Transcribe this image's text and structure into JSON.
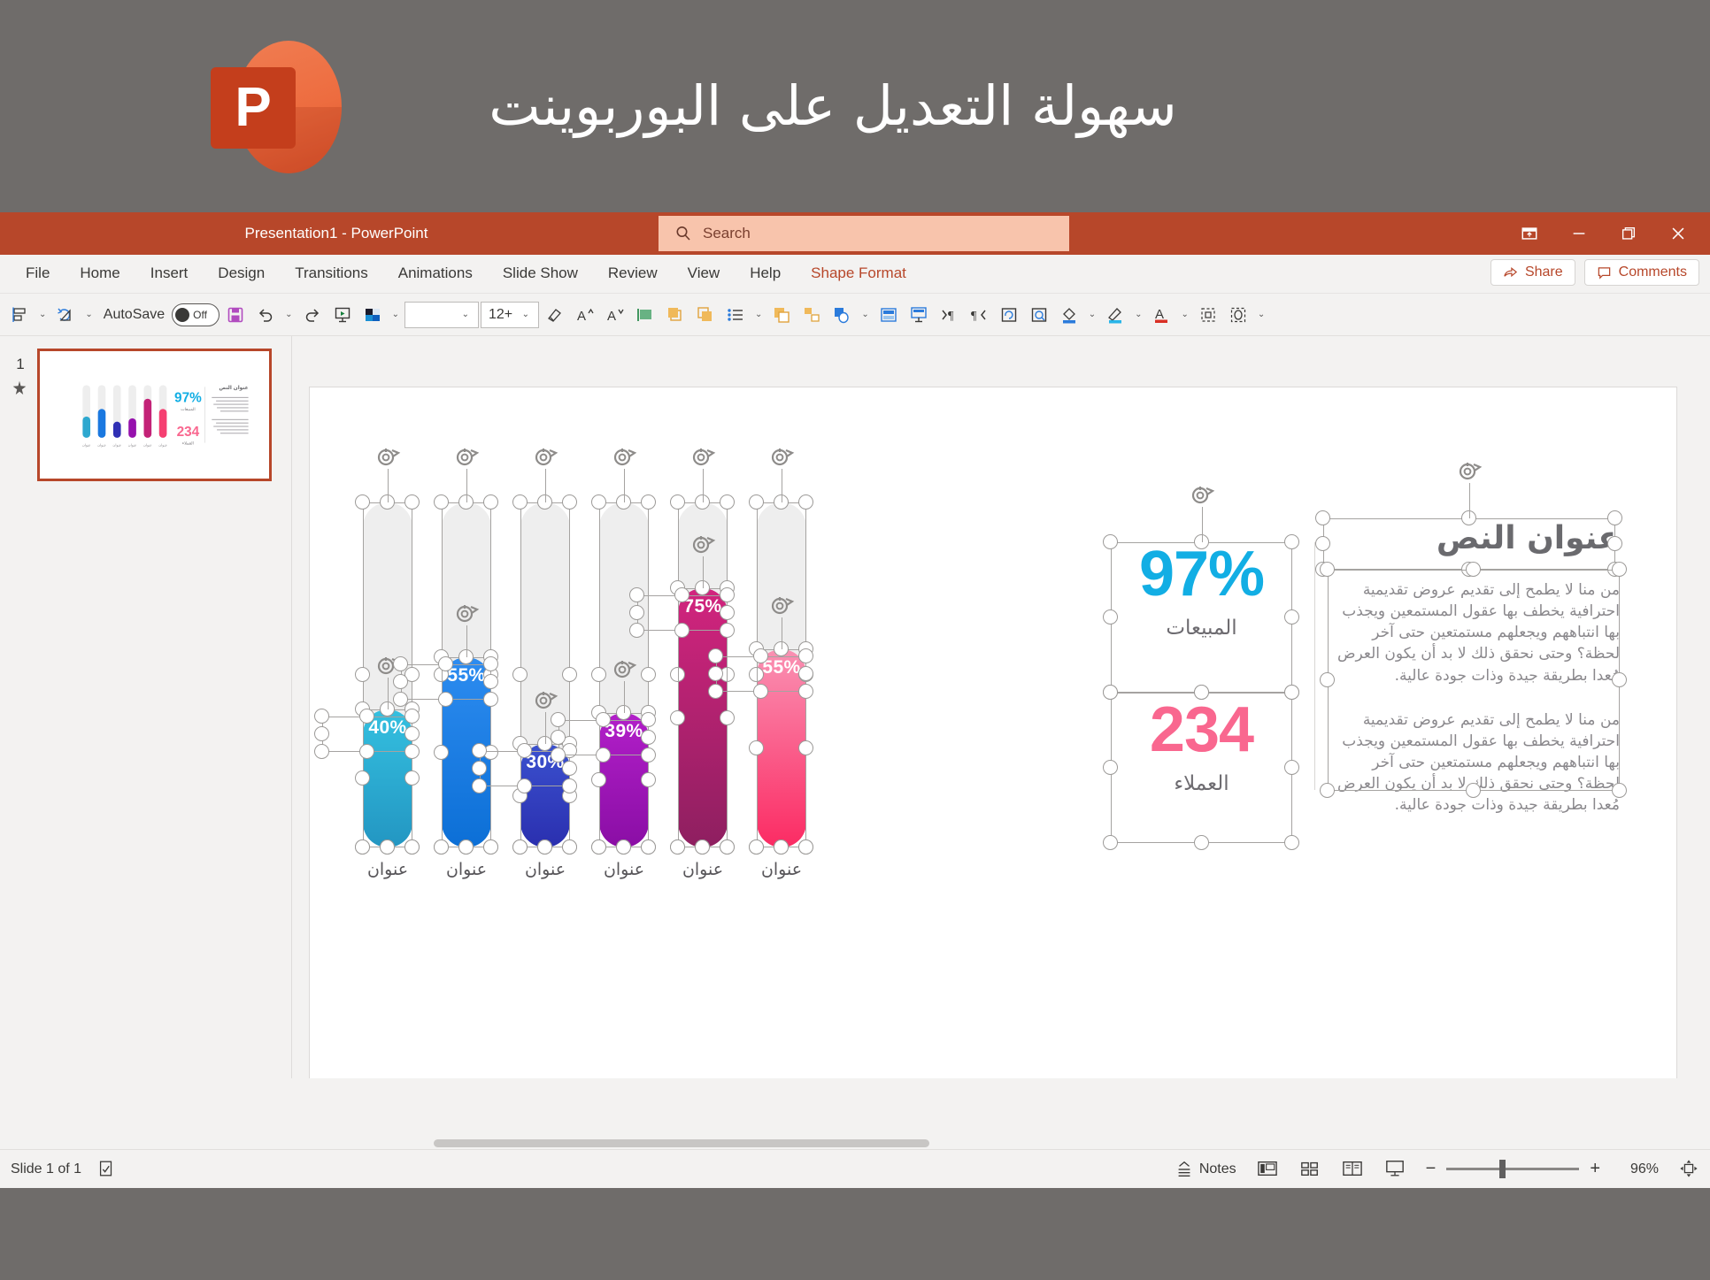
{
  "promo": {
    "title": "سهولة التعديل على البوربوينت",
    "logo_letter": "P",
    "logo_name": "powerpoint-logo"
  },
  "titlebar": {
    "document_title": "Presentation1  -  PowerPoint",
    "search_placeholder": "Search",
    "search_value": "",
    "buttons": {
      "ribbon_display": "ribbon-display-options",
      "minimize": "minimize",
      "restore": "restore",
      "close": "close"
    }
  },
  "ribbon": {
    "tabs": [
      {
        "label": "File",
        "active": false
      },
      {
        "label": "Home",
        "active": false
      },
      {
        "label": "Insert",
        "active": false
      },
      {
        "label": "Design",
        "active": false
      },
      {
        "label": "Transitions",
        "active": false
      },
      {
        "label": "Animations",
        "active": false
      },
      {
        "label": "Slide Show",
        "active": false
      },
      {
        "label": "Review",
        "active": false
      },
      {
        "label": "View",
        "active": false
      },
      {
        "label": "Help",
        "active": false
      },
      {
        "label": "Shape Format",
        "active": true
      }
    ],
    "share_label": "Share",
    "comments_label": "Comments"
  },
  "toolbar": {
    "autosave_label": "AutoSave",
    "autosave_state": "Off",
    "font_name": "",
    "font_size": "12+",
    "icons": [
      "align-objects-icon",
      "rotate-objects-icon",
      "save-icon",
      "undo-icon",
      "redo-icon",
      "start-slideshow-icon",
      "theme-colors-icon",
      "format-painter-icon",
      "increase-font-icon",
      "decrease-font-icon",
      "align-text-icon",
      "bring-forward-icon",
      "send-backward-icon",
      "bullets-icon",
      "duplicate-icon",
      "group-icon",
      "shapes-icon",
      "layout-icon",
      "placeholder-icon",
      "indent-increase-icon",
      "indent-decrease-icon",
      "reset-icon",
      "preview-icon",
      "shape-fill-icon",
      "shape-outline-icon",
      "font-color-icon",
      "selection-pane-icon",
      "align-icon",
      "more-icon"
    ]
  },
  "thumbnail_pane": {
    "slide_number": "1",
    "star_icon": "animation-star-icon"
  },
  "slide": {
    "text_panel": {
      "title": "عنوان النص",
      "paragraphs": [
        "من منا لا يطمح إلى تقديم عروض تقديمية احترافية يخطف بها عقول المستمعين ويجذب بها انتباههم ويجعلهم مستمتعين حتى آخر لحظة؟ وحتى نحقق ذلك لا بد أن يكون العرض مُعدا بطريقة جيدة وذات جودة عالية.",
        "من منا لا يطمح إلى تقديم عروض تقديمية احترافية يخطف بها عقول المستمعين ويجذب بها انتباههم ويجعلهم مستمتعين حتى آخر لحظة؟ وحتى نحقق ذلك لا بد أن يكون العرض مُعدا بطريقة جيدة وذات جودة عالية."
      ]
    },
    "stats": [
      {
        "value": "97%",
        "label": "المبيعات",
        "color": "#12AEE4"
      },
      {
        "value": "234",
        "label": "العملاء",
        "color": "#F9678F"
      }
    ]
  },
  "chart_data": {
    "type": "bar",
    "title": "",
    "categories": [
      "عنوان",
      "عنوان",
      "عنوان",
      "عنوان",
      "عنوان",
      "عنوان"
    ],
    "values": [
      40,
      55,
      30,
      39,
      75,
      55
    ],
    "data_labels": [
      "40%",
      "55%",
      "30%",
      "39%",
      "75%",
      "55%"
    ],
    "series": [
      {
        "name": "progress",
        "values": [
          40,
          55,
          30,
          39,
          75,
          55
        ],
        "colors_top": [
          "#34C0E0",
          "#2D8CF0",
          "#3B51CF",
          "#B21FC9",
          "#D2247E",
          "#FA91B3"
        ],
        "colors_bottom": [
          "#2396C2",
          "#0C6FD6",
          "#2A2FAF",
          "#8A0EA5",
          "#8E1F60",
          "#FB2B63"
        ]
      }
    ],
    "track_color": "#EEEEEE",
    "ylim": [
      0,
      100
    ],
    "ylabel": "",
    "xlabel": "",
    "grid": false,
    "legend": "none",
    "orientation": "vertical",
    "style": "rounded-capsule-progress"
  },
  "status_bar": {
    "slide_indicator": "Slide 1 of 1",
    "accessibility_icon": "accessibility-checker-icon",
    "notes_label": "Notes",
    "view_buttons": [
      "normal-view-icon",
      "slide-sorter-icon",
      "reading-view-icon",
      "slideshow-view-icon"
    ],
    "zoom_out": "−",
    "zoom_in": "+",
    "zoom_level": "96%",
    "fit_slide_icon": "fit-slide-to-window-icon"
  }
}
